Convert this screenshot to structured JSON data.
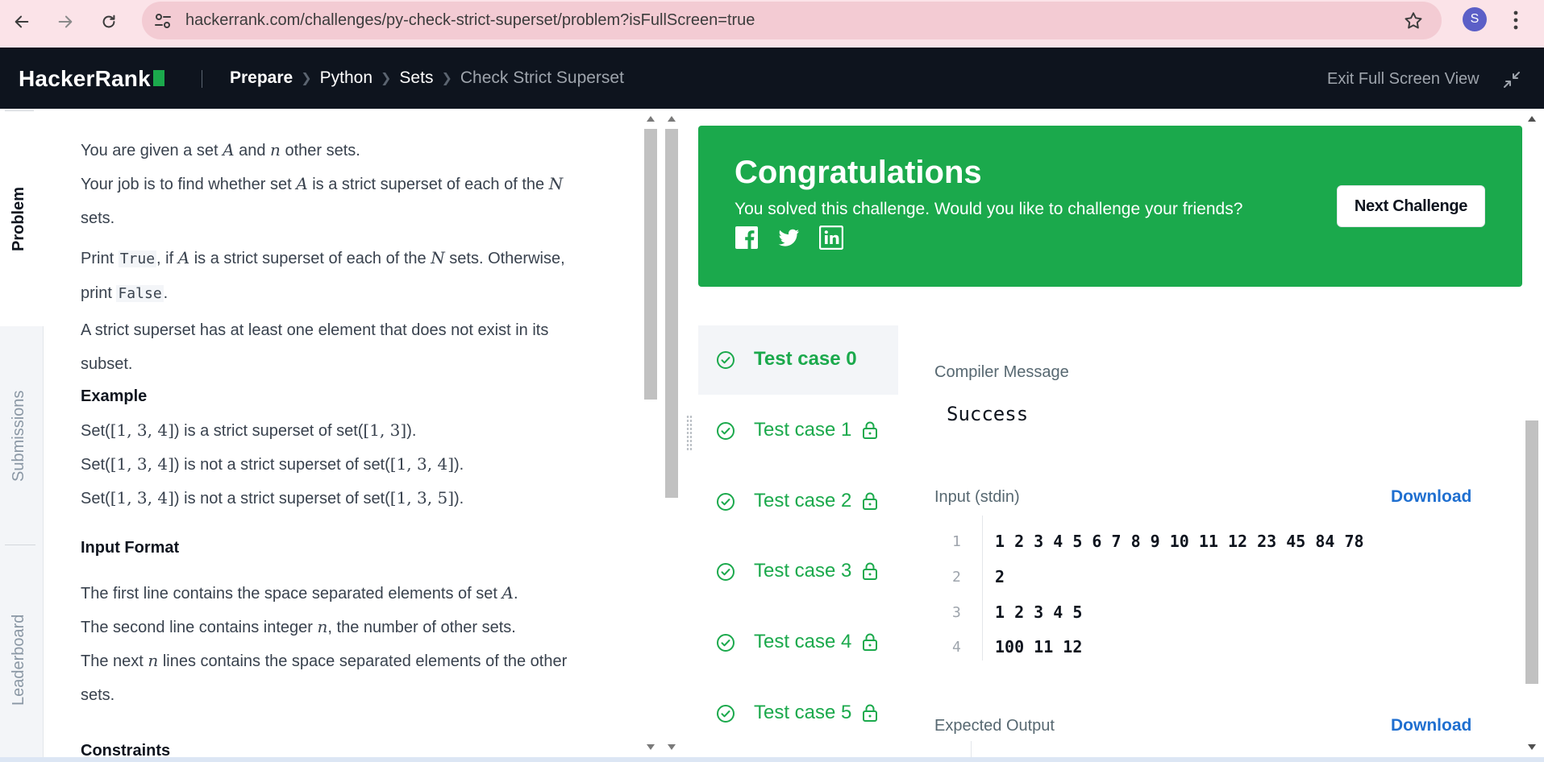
{
  "browser": {
    "url": "hackerrank.com/challenges/py-check-strict-superset/problem?isFullScreen=true",
    "profile_initial": "S"
  },
  "header": {
    "logo": "HackerRank",
    "breadcrumb": [
      "Prepare",
      "Python",
      "Sets",
      "Check Strict Superset"
    ],
    "exit_fullscreen": "Exit Full Screen View"
  },
  "tabs": {
    "problem": "Problem",
    "submissions": "Submissions",
    "leaderboard": "Leaderboard"
  },
  "problem": {
    "l1a": "You are given a set ",
    "l1v": "A",
    "l1b": " and ",
    "l1n": "n",
    "l1c": " other sets.",
    "l2a": "Your job is to find whether set ",
    "l2v": "A",
    "l2b": " is a strict superset of each of the ",
    "l2n": "N",
    "l2c": " sets.",
    "l3a": "Print ",
    "l3true": "True",
    "l3b": ", if ",
    "l3v": "A",
    "l3c": " is a strict superset of each of the ",
    "l3n": "N",
    "l3d": " sets. Otherwise, print ",
    "l3false": "False",
    "l3e": ".",
    "l4": "A strict superset has at least one element that does not exist in its subset.",
    "example_title": "Example",
    "ex1a": "Set(",
    "ex1s1": "[1, 3, 4]",
    "ex1b": ") is a strict superset of set(",
    "ex1s2": "[1, 3]",
    "ex1c": ").",
    "ex2a": "Set(",
    "ex2s1": "[1, 3, 4]",
    "ex2b": ") is not a strict superset of set(",
    "ex2s2": "[1, 3, 4]",
    "ex2c": ").",
    "ex3a": "Set(",
    "ex3s1": "[1, 3, 4]",
    "ex3b": ") is not a strict superset of set(",
    "ex3s2": "[1, 3, 5]",
    "ex3c": ").",
    "input_title": "Input Format",
    "in1a": "The first line contains the space separated elements of set ",
    "in1v": "A",
    "in1b": ".",
    "in2a": "The second line contains integer ",
    "in2v": "n",
    "in2b": ", the number of other sets.",
    "in3a": "The next ",
    "in3v": "n",
    "in3b": " lines contains the space separated elements of the other sets.",
    "constraints_title": "Constraints"
  },
  "congrats": {
    "title": "Congratulations",
    "subtitle": "You solved this challenge. Would you like to challenge your friends?",
    "next_button": "Next Challenge",
    "social": [
      "facebook-icon",
      "twitter-icon",
      "linkedin-icon"
    ],
    "bg_color": "#1ba94c"
  },
  "test_cases": [
    {
      "label": "Test case 0",
      "active": true,
      "locked": false
    },
    {
      "label": "Test case 1",
      "active": false,
      "locked": true
    },
    {
      "label": "Test case 2",
      "active": false,
      "locked": true
    },
    {
      "label": "Test case 3",
      "active": false,
      "locked": true
    },
    {
      "label": "Test case 4",
      "active": false,
      "locked": true
    },
    {
      "label": "Test case 5",
      "active": false,
      "locked": true
    }
  ],
  "output": {
    "compiler_label": "Compiler Message",
    "compiler_message": "Success",
    "input_label": "Input (stdin)",
    "download": "Download",
    "input_lines": [
      {
        "n": "1",
        "text": "1 2 3 4 5 6 7 8 9 10 11 12 23 45 84 78"
      },
      {
        "n": "2",
        "text": "2"
      },
      {
        "n": "3",
        "text": "1 2 3 4 5"
      },
      {
        "n": "4",
        "text": "100 11 12"
      }
    ],
    "expected_label": "Expected Output",
    "download2": "Download"
  }
}
